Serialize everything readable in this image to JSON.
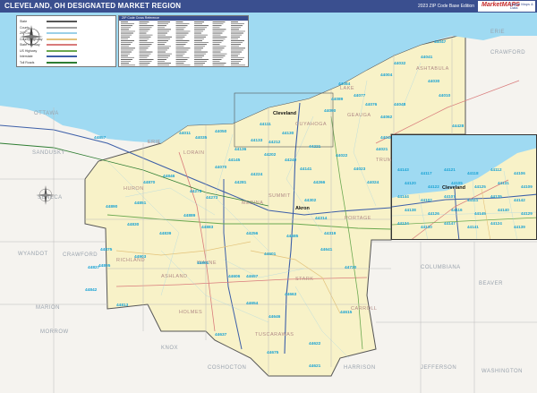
{
  "title": "CLEVELAND, OH DESIGNATED MARKET REGION",
  "edition": "2023 ZIP Code Base Edition",
  "logo": {
    "brand": "MarketMAPS",
    "tagline": "Digital Maps & Data"
  },
  "legend": {
    "items": [
      {
        "label": "State",
        "color": "#555555"
      },
      {
        "label": "County",
        "color": "#a0a0a0"
      },
      {
        "label": "ZIP Code",
        "color": "#9bd0e8"
      },
      {
        "label": "County Highway",
        "color": "#e3c27a"
      },
      {
        "label": "State Highway",
        "color": "#d97b7b"
      },
      {
        "label": "US Highway",
        "color": "#6aa84f"
      },
      {
        "label": "Interstate",
        "color": "#3d5fa8"
      },
      {
        "label": "Toll Roads",
        "color": "#2e7d32"
      }
    ]
  },
  "zip_table": {
    "header": "ZIP Code Cross Reference"
  },
  "water": {
    "lake": "#9fdaf2"
  },
  "counties": [
    {
      "name": "OTTAWA",
      "kind": "outside"
    },
    {
      "name": "SANDUSKY",
      "kind": "outside"
    },
    {
      "name": "SENECA",
      "kind": "outside"
    },
    {
      "name": "CRAWFORD",
      "kind": "outside"
    },
    {
      "name": "MARION",
      "kind": "outside"
    },
    {
      "name": "MORROW",
      "kind": "outside"
    },
    {
      "name": "WYANDOT",
      "kind": "outside"
    },
    {
      "name": "KNOX",
      "kind": "outside"
    },
    {
      "name": "COSHOCTON",
      "kind": "outside"
    },
    {
      "name": "HARRISON",
      "kind": "outside"
    },
    {
      "name": "JEFFERSON",
      "kind": "outside"
    },
    {
      "name": "COLUMBIANA",
      "kind": "outside"
    },
    {
      "name": "BEAVER",
      "kind": "outside"
    },
    {
      "name": "WASHINGTON",
      "kind": "outside"
    },
    {
      "name": "ERIE",
      "kind": "outside"
    },
    {
      "name": "CRAWFORD",
      "kind": "outside"
    },
    {
      "name": "LORAIN",
      "kind": "inside"
    },
    {
      "name": "HURON",
      "kind": "inside"
    },
    {
      "name": "MEDINA",
      "kind": "inside"
    },
    {
      "name": "ASHLAND",
      "kind": "inside"
    },
    {
      "name": "RICHLAND",
      "kind": "inside"
    },
    {
      "name": "WAYNE",
      "kind": "inside"
    },
    {
      "name": "HOLMES",
      "kind": "inside"
    },
    {
      "name": "TUSCARAWAS",
      "kind": "inside"
    },
    {
      "name": "CARROLL",
      "kind": "inside"
    },
    {
      "name": "STARK",
      "kind": "inside"
    },
    {
      "name": "PORTAGE",
      "kind": "inside"
    },
    {
      "name": "SUMMIT",
      "kind": "inside"
    },
    {
      "name": "GEAUGA",
      "kind": "inside"
    },
    {
      "name": "LAKE",
      "kind": "inside"
    },
    {
      "name": "ASHTABULA",
      "kind": "inside"
    },
    {
      "name": "TRUMBULL",
      "kind": "inside"
    },
    {
      "name": "CUYAHOGA",
      "kind": "inside"
    },
    {
      "name": "ERIE",
      "kind": "inside"
    }
  ],
  "cities": [
    {
      "name": "Akron"
    },
    {
      "name": "Cleveland"
    }
  ],
  "zips": [
    {
      "code": "44047"
    },
    {
      "code": "44041"
    },
    {
      "code": "44032"
    },
    {
      "code": "44004"
    },
    {
      "code": "44084"
    },
    {
      "code": "44077"
    },
    {
      "code": "44076"
    },
    {
      "code": "44062"
    },
    {
      "code": "44011"
    },
    {
      "code": "44035"
    },
    {
      "code": "44050"
    },
    {
      "code": "44090"
    },
    {
      "code": "44089"
    },
    {
      "code": "44857"
    },
    {
      "code": "44890"
    },
    {
      "code": "44851"
    },
    {
      "code": "44805"
    },
    {
      "code": "44903"
    },
    {
      "code": "44827"
    },
    {
      "code": "44875"
    },
    {
      "code": "44813"
    },
    {
      "code": "44842"
    },
    {
      "code": "44691"
    },
    {
      "code": "44606"
    },
    {
      "code": "44654"
    },
    {
      "code": "44637"
    },
    {
      "code": "44622"
    },
    {
      "code": "44663"
    },
    {
      "code": "44615"
    },
    {
      "code": "44646"
    },
    {
      "code": "44720"
    },
    {
      "code": "44641"
    },
    {
      "code": "44256"
    },
    {
      "code": "44281"
    },
    {
      "code": "44273"
    },
    {
      "code": "44278"
    },
    {
      "code": "44224"
    },
    {
      "code": "44266"
    },
    {
      "code": "44240"
    },
    {
      "code": "44202"
    },
    {
      "code": "44221"
    },
    {
      "code": "44212"
    },
    {
      "code": "44133"
    },
    {
      "code": "44136"
    },
    {
      "code": "44145"
    },
    {
      "code": "44070"
    },
    {
      "code": "44111"
    },
    {
      "code": "44130"
    },
    {
      "code": "44141"
    },
    {
      "code": "44022"
    },
    {
      "code": "44023"
    },
    {
      "code": "44024"
    },
    {
      "code": "44021"
    },
    {
      "code": "44046"
    },
    {
      "code": "44048"
    },
    {
      "code": "44030"
    },
    {
      "code": "44010"
    },
    {
      "code": "44428"
    },
    {
      "code": "44870"
    },
    {
      "code": "44846"
    },
    {
      "code": "44839"
    },
    {
      "code": "44889"
    },
    {
      "code": "44883"
    },
    {
      "code": "44830"
    },
    {
      "code": "44302"
    },
    {
      "code": "44314"
    },
    {
      "code": "44319"
    },
    {
      "code": "44685"
    },
    {
      "code": "44601"
    },
    {
      "code": "44657"
    },
    {
      "code": "44675"
    },
    {
      "code": "44621"
    }
  ],
  "inset": {
    "label": "Cleveland",
    "zips": [
      {
        "code": "44143"
      },
      {
        "code": "44117"
      },
      {
        "code": "44121"
      },
      {
        "code": "44118"
      },
      {
        "code": "44112"
      },
      {
        "code": "44106"
      },
      {
        "code": "44120"
      },
      {
        "code": "44122"
      },
      {
        "code": "44105"
      },
      {
        "code": "44125"
      },
      {
        "code": "44131"
      },
      {
        "code": "44109"
      },
      {
        "code": "44144"
      },
      {
        "code": "44102"
      },
      {
        "code": "44107"
      },
      {
        "code": "44111"
      },
      {
        "code": "44135"
      },
      {
        "code": "44142"
      },
      {
        "code": "44138"
      },
      {
        "code": "44126"
      },
      {
        "code": "44116"
      },
      {
        "code": "44145"
      },
      {
        "code": "44140"
      },
      {
        "code": "44129"
      },
      {
        "code": "44134"
      },
      {
        "code": "44130"
      },
      {
        "code": "44147"
      },
      {
        "code": "44141"
      },
      {
        "code": "44124"
      },
      {
        "code": "44139"
      }
    ]
  }
}
